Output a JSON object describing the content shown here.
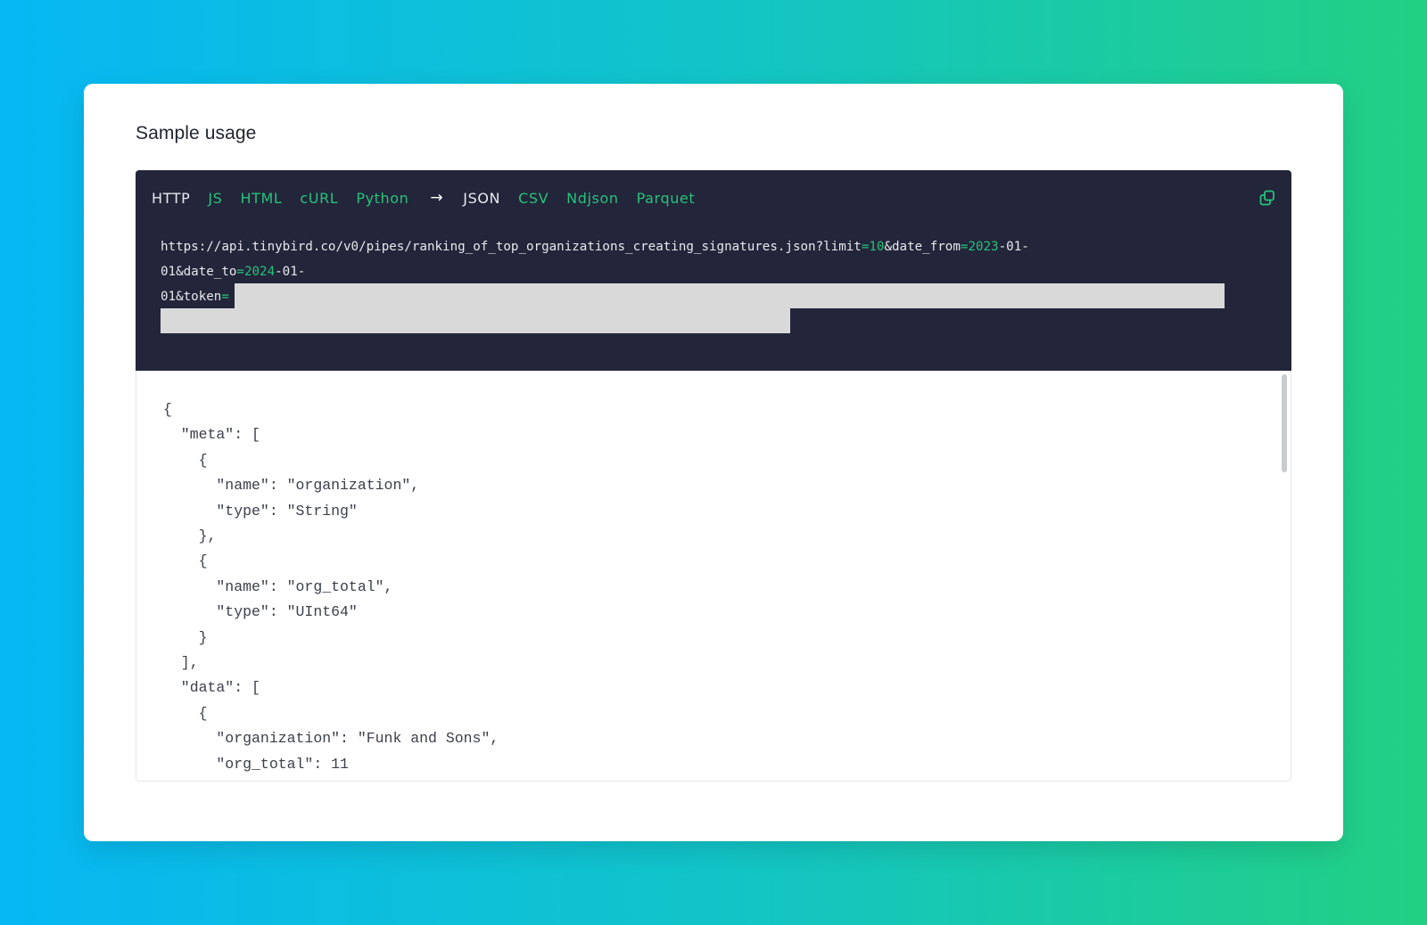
{
  "card": {
    "title": "Sample usage"
  },
  "tabs": {
    "languages": [
      "HTTP",
      "JS",
      "HTML",
      "cURL",
      "Python"
    ],
    "arrow": "→",
    "formats": [
      "JSON",
      "CSV",
      "Ndjson",
      "Parquet"
    ],
    "active_language": "HTTP",
    "active_format": "JSON"
  },
  "copy_icon": "copy-icon",
  "url": {
    "line1_base": "https://api.tinybird.co/v0/pipes/ranking_of_top_organizations_creating_signatures.json?limit",
    "eq1": "=",
    "limit_value": "10",
    "date_from_key": "&date_from",
    "eq2": "=",
    "date_from_year": "2023",
    "date_from_rest_a": "-01-",
    "line2_start": "01&date_to",
    "eq3": "=",
    "date_to_year": "2024",
    "date_to_rest_a": "-01-",
    "line3_start": "01&token",
    "eq4": "="
  },
  "response_lines": [
    "{",
    "  \"meta\": [",
    "    {",
    "      \"name\": \"organization\",",
    "      \"type\": \"String\"",
    "    },",
    "    {",
    "      \"name\": \"org_total\",",
    "      \"type\": \"UInt64\"",
    "    }",
    "  ],",
    "  \"data\": [",
    "    {",
    "      \"organization\": \"Funk and Sons\",",
    "      \"org_total\": 11"
  ],
  "colors": {
    "code_bg": "#23253a",
    "accent": "#27c27a",
    "tab_active": "#e8e9ee"
  }
}
